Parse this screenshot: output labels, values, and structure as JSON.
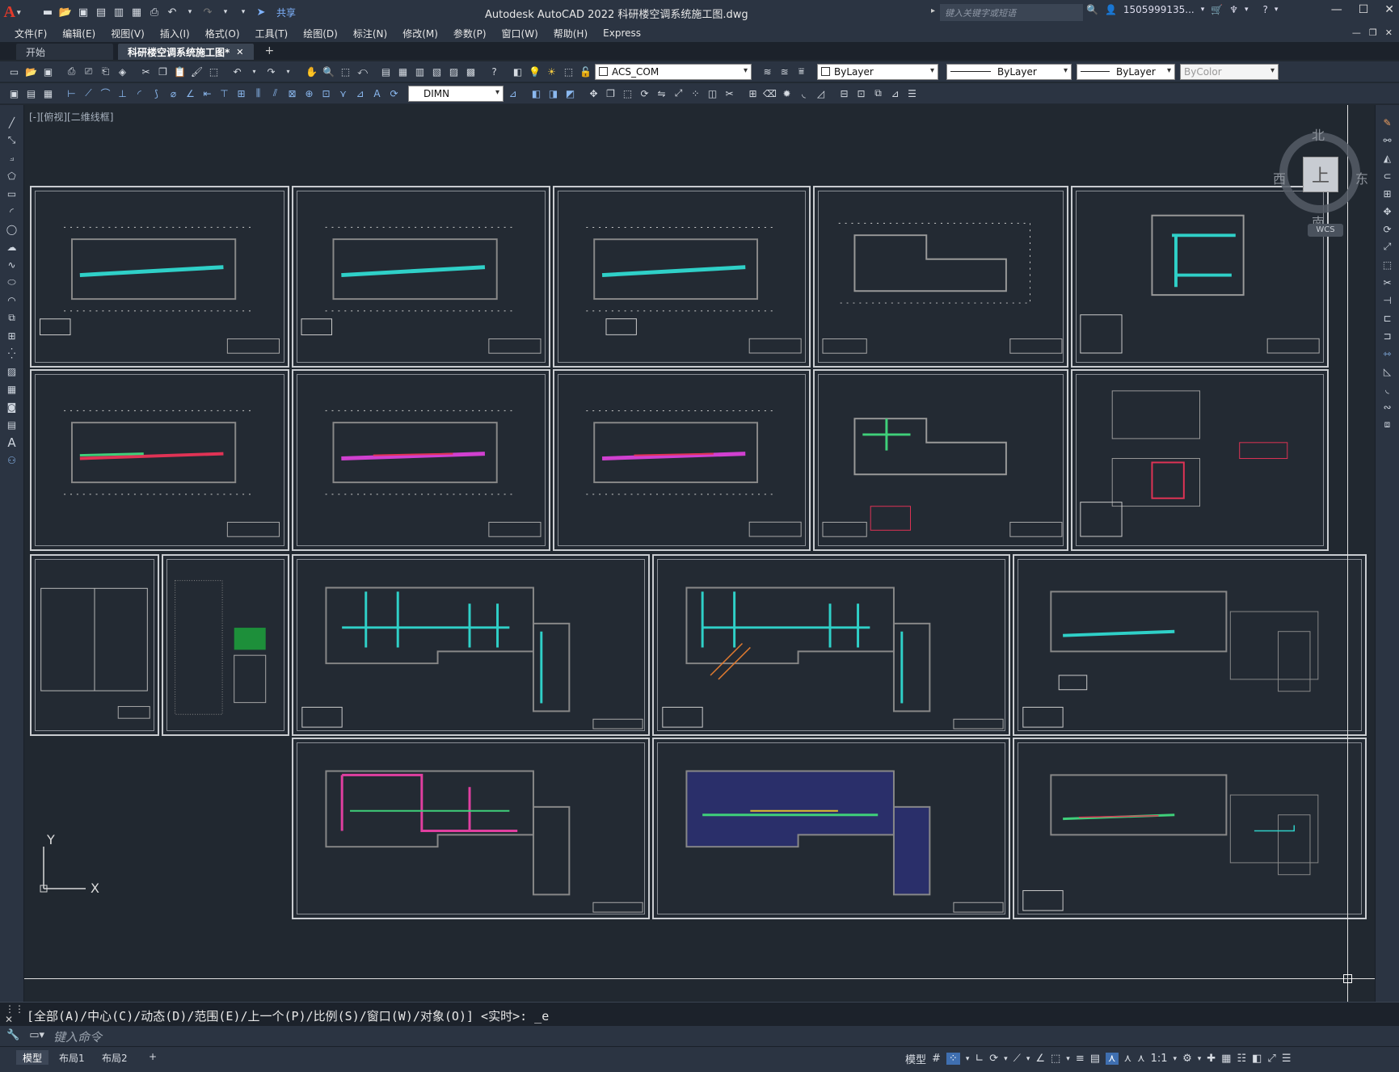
{
  "titlebar": {
    "app_letter": "A",
    "share": "共享",
    "title": "Autodesk AutoCAD 2022    科研楼空调系统施工图.dwg",
    "search_placeholder": "键入关键字或短语",
    "user": "1505999135...",
    "min": "—",
    "max": "☐",
    "close": "✕"
  },
  "menu": [
    "文件(F)",
    "编辑(E)",
    "视图(V)",
    "插入(I)",
    "格式(O)",
    "工具(T)",
    "绘图(D)",
    "标注(N)",
    "修改(M)",
    "参数(P)",
    "窗口(W)",
    "帮助(H)",
    "Express"
  ],
  "tabs": {
    "start": "开始",
    "active": "科研楼空调系统施工图*",
    "close": "✕",
    "add": "+"
  },
  "toolbar": {
    "layer": "ACS_COM",
    "color": "ByLayer",
    "linetype": "ByLayer",
    "lineweight": "ByLayer",
    "plotstyle": "ByColor",
    "dimstyle": "DIMN"
  },
  "canvas": {
    "view_label": "[-][俯视][二维线框]"
  },
  "viewcube": {
    "top": "上",
    "north": "北",
    "south": "南",
    "east": "东",
    "west": "西",
    "wcs": "WCS"
  },
  "ucs": {
    "x": "X",
    "y": "Y"
  },
  "command": {
    "history": "[全部(A)/中心(C)/动态(D)/范围(E)/上一个(P)/比例(S)/窗口(W)/对象(O)] <实时>: _e",
    "prompt": "键入命令"
  },
  "status": {
    "model": "模型",
    "layout1": "布局1",
    "layout2": "布局2",
    "add": "+",
    "model_btn": "模型",
    "scale": "1:1"
  }
}
